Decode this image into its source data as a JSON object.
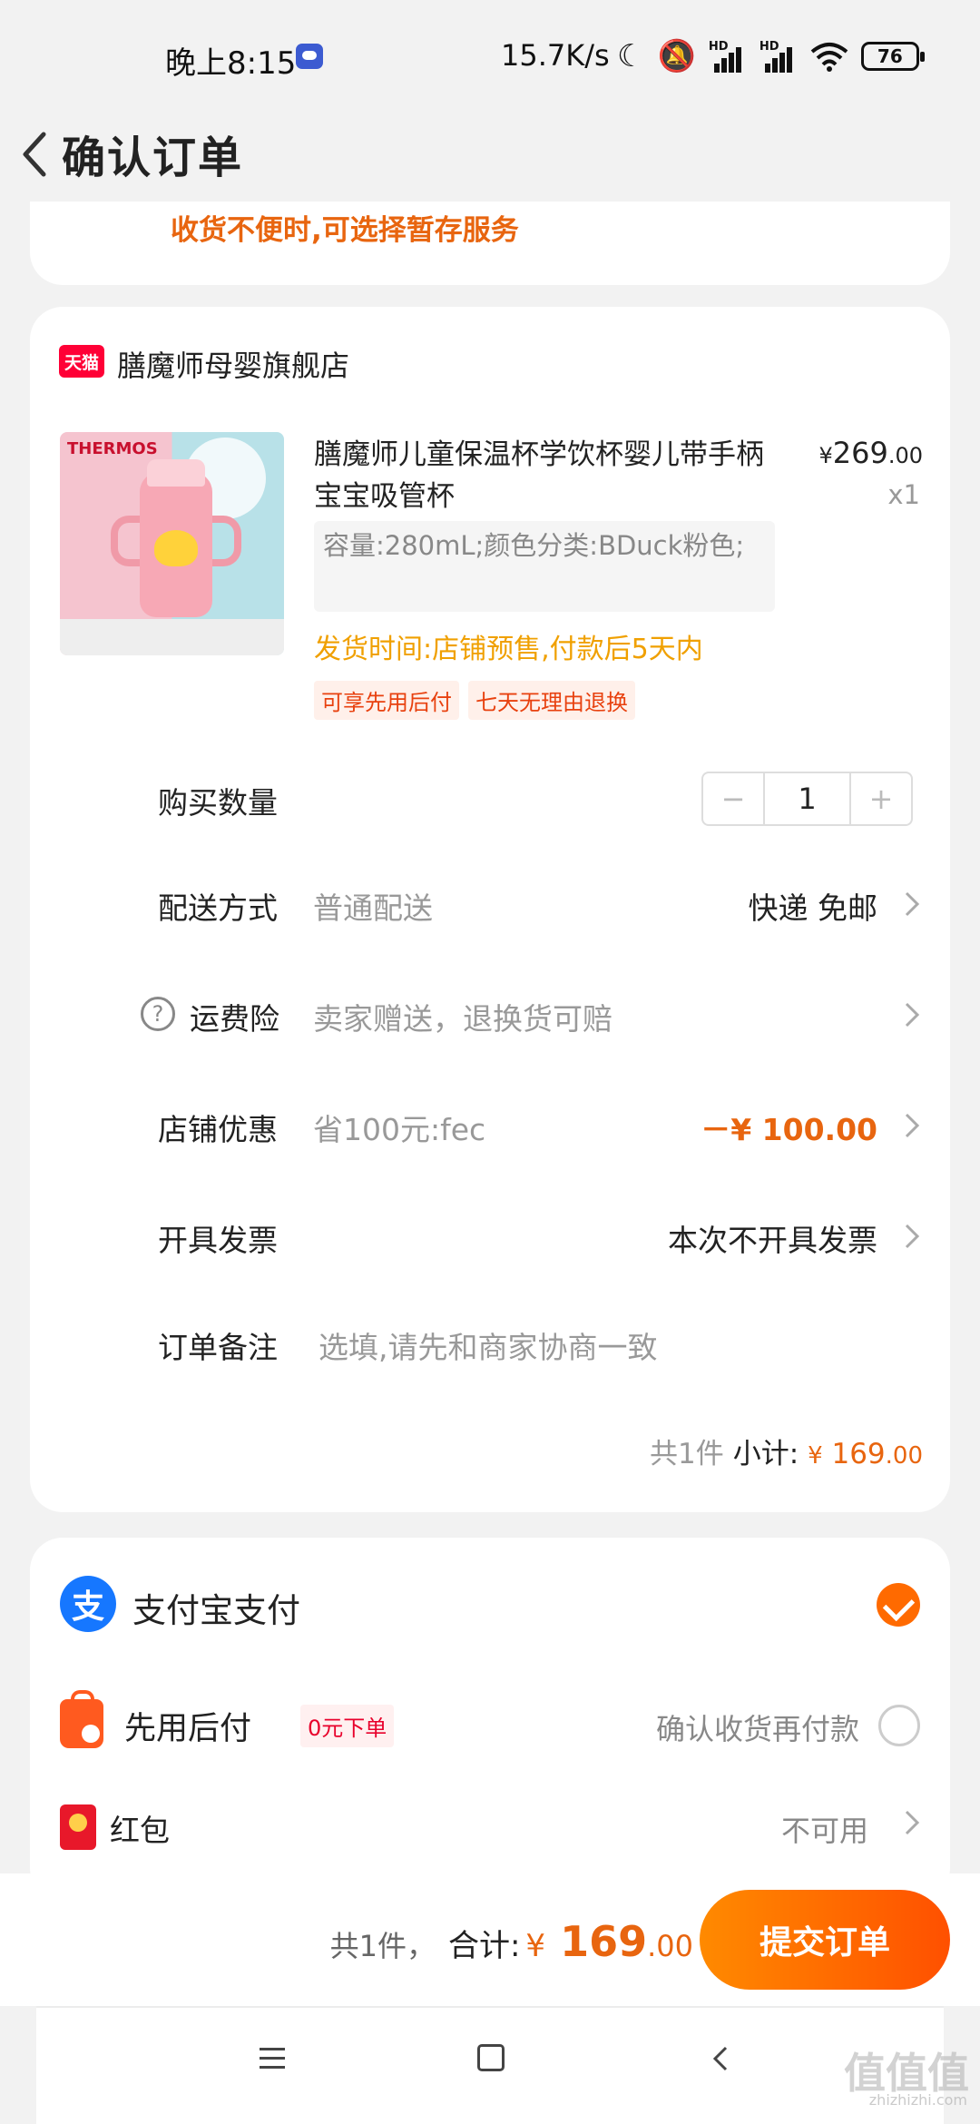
{
  "status": {
    "time": "晚上8:15",
    "speed": "15.7K/s",
    "net1": "HD",
    "net2": "HD",
    "battery": "76"
  },
  "header": {
    "title": "确认订单"
  },
  "notice": "收货不便时,可选择暂存服务",
  "shop": {
    "badge": "天猫",
    "name": "膳魔师母婴旗舰店"
  },
  "product": {
    "image_brand": "THERMOS",
    "title": "膳魔师儿童保温杯学饮杯婴儿带手柄宝宝吸管杯",
    "price_symbol": "¥",
    "price_int": "269",
    "price_dec": ".00",
    "qty": "x1",
    "sku": "容量:280mL;颜色分类:BDuck粉色;",
    "ship_time": "发货时间:店铺预售,付款后5天内",
    "tags": [
      "可享先用后付",
      "七天无理由退换"
    ]
  },
  "quantity": {
    "label": "购买数量",
    "minus": "−",
    "value": "1",
    "plus": "+"
  },
  "delivery": {
    "label": "配送方式",
    "sub": "普通配送",
    "value": "快递 免邮"
  },
  "insurance": {
    "help": "?",
    "label": "运费险",
    "sub": "卖家赠送，退换货可赔"
  },
  "coupon": {
    "label": "店铺优惠",
    "sub": "省100元:fec",
    "value": "－¥ 100.00"
  },
  "invoice": {
    "label": "开具发票",
    "value": "本次不开具发票"
  },
  "remark": {
    "label": "订单备注",
    "placeholder": "选填,请先和商家协商一致"
  },
  "subtotal": {
    "count": "共1件",
    "label": "小计:",
    "symbol": "¥",
    "int": "169",
    "dec": ".00"
  },
  "payment": {
    "alipay_glyph": "支",
    "alipay": "支付宝支付",
    "later": "先用后付",
    "later_badge": "0元下单",
    "later_desc": "确认收货再付款",
    "hongbao": "红包",
    "hongbao_status": "不可用"
  },
  "footer": {
    "count": "共1件，",
    "label": "合计:",
    "symbol": "¥",
    "int": "169",
    "dec": ".00",
    "submit": "提交订单"
  },
  "watermark": {
    "main": "值值值",
    "sub": "zhizhizhi.com"
  },
  "colors": {
    "accent": "#ff6a00",
    "price": "#e8650f",
    "alipay": "#1677ff",
    "tmall": "#ff0036"
  }
}
